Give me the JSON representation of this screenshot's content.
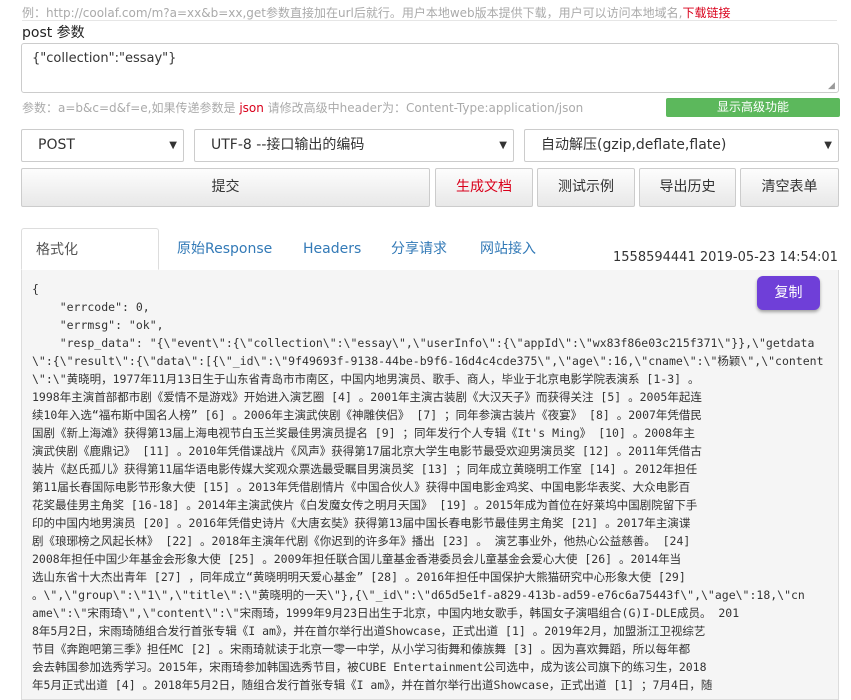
{
  "example": {
    "text": "例：http://coolaf.com/m?a=xx&b=xx,get参数直接加在url后就行。用户本地web版本提供下载，用户可以访问本地域名,",
    "download_link": "下载链接"
  },
  "post": {
    "label": "post 参数",
    "value": "{\"collection\":\"essay\"}"
  },
  "hint": {
    "prefix": "参数：a=b&c=d&f=e,如果传递参数是 ",
    "json": "json",
    "suffix": " 请修改高级中header为：Content-Type:application/json"
  },
  "advanced_button": "显示高级功能",
  "selects": {
    "method": "POST",
    "encoding": "UTF-8 --接口输出的编码",
    "compression": "自动解压(gzip,deflate,flate)"
  },
  "buttons": {
    "submit": "提交",
    "generate_doc": "生成文档",
    "test_example": "测试示例",
    "export_history": "导出历史",
    "clear_form": "清空表单"
  },
  "tabs": [
    "格式化Response",
    "原始Response",
    "Headers",
    "分享请求",
    "网站接入"
  ],
  "timestamp": "1558594441 2019-05-23 14:54:01",
  "copy_button": "复制",
  "response_text": "{\n    \"errcode\": 0,\n    \"errmsg\": \"ok\",\n    \"resp_data\": \"{\\\"event\\\":{\\\"collection\\\":\\\"essay\\\",\\\"userInfo\\\":{\\\"appId\\\":\\\"wx83f86e03c215f371\\\"}},\\\"getdata\n\\\":{\\\"result\\\":{\\\"data\\\":[{\\\"_id\\\":\\\"9f49693f-9138-44be-b9f6-16d4c4cde375\\\",\\\"age\\\":16,\\\"cname\\\":\\\"杨颖\\\",\\\"content\n\\\":\\\"黄晓明，1977年11月13日生于山东省青岛市市南区，中国内地男演员、歌手、商人，毕业于北京电影学院表演系 [1-3] 。\n1998年主演首部都市剧《爱情不是游戏》开始进入演艺圈 [4] 。2001年主演古装剧《大汉天子》而获得关注 [5] 。2005年起连\n续10年入选“福布斯中国名人榜” [6] 。2006年主演武侠剧《神雕侠侣》 [7] ；同年参演古装片《夜宴》 [8] 。2007年凭借民\n国剧《新上海滩》获得第13届上海电视节白玉兰奖最佳男演员提名 [9] ；同年发行个人专辑《It's Ming》 [10] 。2008年主\n演武侠剧《鹿鼎记》 [11] 。2010年凭借谍战片《风声》获得第17届北京大学生电影节最受欢迎男演员奖 [12] 。2011年凭借古\n装片《赵氏孤儿》获得第11届华语电影传媒大奖观众票选最受瞩目男演员奖 [13] ；同年成立黄晓明工作室 [14] 。2012年担任\n第11届长春国际电影节形象大使 [15] 。2013年凭借剧情片《中国合伙人》获得中国电影金鸡奖、中国电影华表奖、大众电影百\n花奖最佳男主角奖 [16-18] 。2014年主演武侠片《白发魔女传之明月天国》 [19] 。2015年成为首位在好莱坞中国剧院留下手\n印的中国内地男演员 [20] 。2016年凭借史诗片《大唐玄奘》获得第13届中国长春电影节最佳男主角奖 [21] 。2017年主演谍\n剧《琅琊榜之风起长林》 [22] 。2018年主演年代剧《你迟到的许多年》播出 [23] 。 演艺事业外，他热心公益慈善。 [24]\n2008年担任中国少年基金会形象大使 [25] 。2009年担任联合国儿童基金香港委员会儿童基金会爱心大使 [26] 。2014年当\n选山东省十大杰出青年 [27] ，同年成立“黄晓明明天爱心基金” [28] 。2016年担任中国保护大熊猫研究中心形象大使 [29]\n。\\\",\\\"group\\\":\\\"1\\\",\\\"title\\\":\\\"黄晓明的一天\\\"},{\\\"_id\\\":\\\"d65d5e1f-a829-413b-ad59-e76c6a75443f\\\",\\\"age\\\":18,\\\"cn\name\\\":\\\"宋雨琦\\\",\\\"content\\\":\\\"宋雨琦，1999年9月23日出生于北京，中国内地女歌手，韩国女子演唱组合(G)I-DLE成员。 201\n8年5月2日，宋雨琦随组合发行首张专辑《I am》，并在首尔举行出道Showcase，正式出道 [1] 。2019年2月，加盟浙江卫视综艺\n节目《奔跑吧第三季》担任MC [2] 。宋雨琦就读于北京一零一中学，从小学习街舞和傣族舞 [3] 。因为喜欢舞蹈，所以每年都\n会去韩国参加选秀学习。2015年，宋雨琦参加韩国选秀节目，被CUBE Entertainment公司选中，成为该公司旗下的练习生，2018\n年5月正式出道 [4] 。2018年5月2日，随组合发行首张专辑《I am》，并在首尔举行出道Showcase，正式出道 [1] ；7月4日，随"
}
